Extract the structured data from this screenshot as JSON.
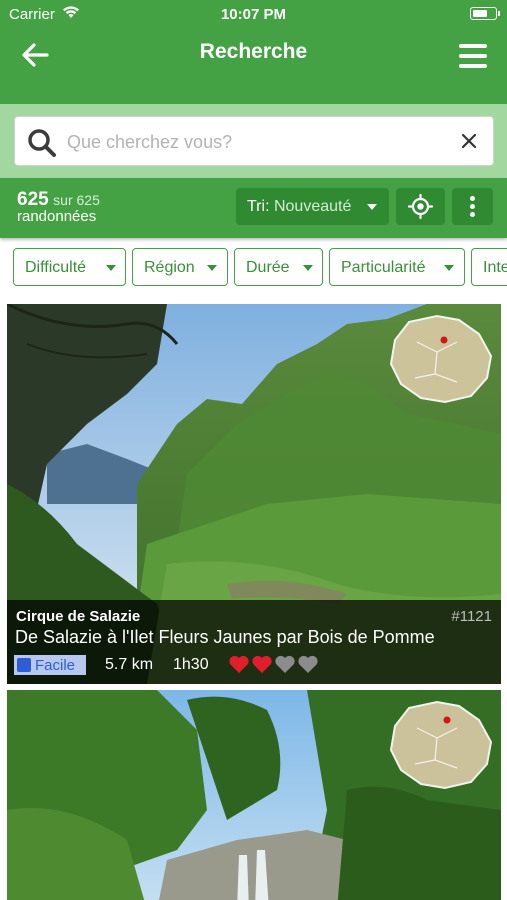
{
  "status_bar": {
    "carrier": "Carrier",
    "time": "10:07 PM"
  },
  "header": {
    "title": "Recherche",
    "icons": {
      "back": "arrow-left-icon",
      "menu": "hamburger-menu-icon"
    }
  },
  "search": {
    "placeholder": "Que cherchez vous?",
    "value": "",
    "icons": {
      "search": "search-icon",
      "clear": "close-icon"
    }
  },
  "results": {
    "count": "625",
    "of_label": "sur 625",
    "unit": "randonnées"
  },
  "sort": {
    "label": "Tri:",
    "value": "Nouveauté"
  },
  "toolbar_icons": {
    "locate": "crosshair-location-icon",
    "more": "vertical-dots-icon"
  },
  "filters": [
    {
      "label": "Difficulté"
    },
    {
      "label": "Région"
    },
    {
      "label": "Durée"
    },
    {
      "label": "Particularité"
    },
    {
      "label": "Inte"
    }
  ],
  "cards": [
    {
      "region": "Cirque de Salazie",
      "id": "#1121",
      "name": "De Salazie à l'Ilet Fleurs Jaunes par Bois de Pomme",
      "difficulty": "Facile",
      "distance": "5.7 km",
      "duration": "1h30",
      "rating": 2,
      "rating_max": 4
    },
    {
      "region": "",
      "id": "",
      "name": ""
    }
  ],
  "colors": {
    "primary": "#44a244",
    "primary_dark": "#2f8a32",
    "band": "#a3d7a0",
    "heart_on": "#e01e2c",
    "heart_off": "#8c8c8c",
    "badge_bg": "#b7c8ef",
    "badge_fg": "#2f5dd5"
  }
}
